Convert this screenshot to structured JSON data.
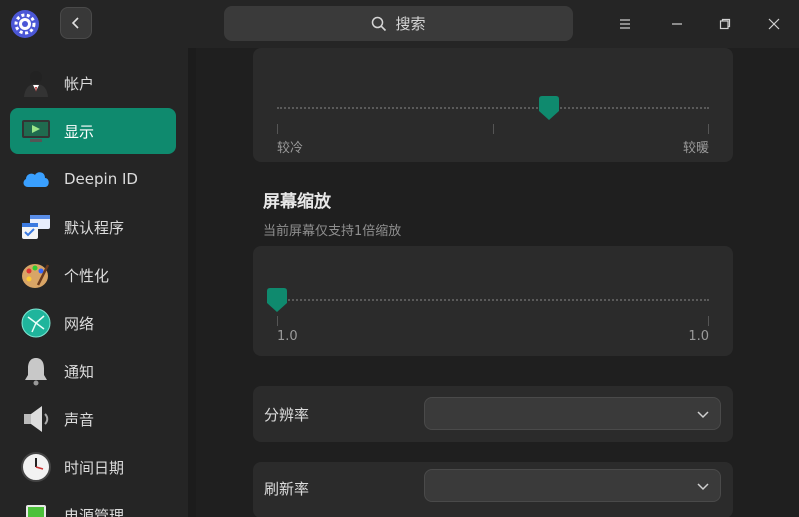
{
  "titlebar": {
    "search_placeholder": "搜索",
    "icons": [
      "settings-app-icon",
      "back-icon",
      "search-icon",
      "menu-icon",
      "minimize-icon",
      "restore-icon",
      "close-icon"
    ]
  },
  "sidebar": {
    "items": [
      {
        "label": "帐户",
        "icon": "account-icon",
        "active": false
      },
      {
        "label": "显示",
        "icon": "display-icon",
        "active": true
      },
      {
        "label": "Deepin ID",
        "icon": "cloud-icon",
        "active": false
      },
      {
        "label": "默认程序",
        "icon": "default-apps-icon",
        "active": false
      },
      {
        "label": "个性化",
        "icon": "personalization-icon",
        "active": false
      },
      {
        "label": "网络",
        "icon": "network-icon",
        "active": false
      },
      {
        "label": "通知",
        "icon": "bell-icon",
        "active": false
      },
      {
        "label": "声音",
        "icon": "speaker-icon",
        "active": false
      },
      {
        "label": "时间日期",
        "icon": "clock-icon",
        "active": false
      },
      {
        "label": "电源管理",
        "icon": "battery-icon",
        "active": false
      }
    ],
    "accent": "#0f8a6e"
  },
  "color_temperature": {
    "min_label": "较冷",
    "max_label": "较暖",
    "value_fraction": 0.63
  },
  "scaling": {
    "title": "屏幕缩放",
    "subtitle": "当前屏幕仅支持1倍缩放",
    "min_label": "1.0",
    "max_label": "1.0",
    "value_fraction": 0.0
  },
  "resolution": {
    "label": "分辨率",
    "value": ""
  },
  "refresh_rate": {
    "label": "刷新率",
    "value": ""
  }
}
